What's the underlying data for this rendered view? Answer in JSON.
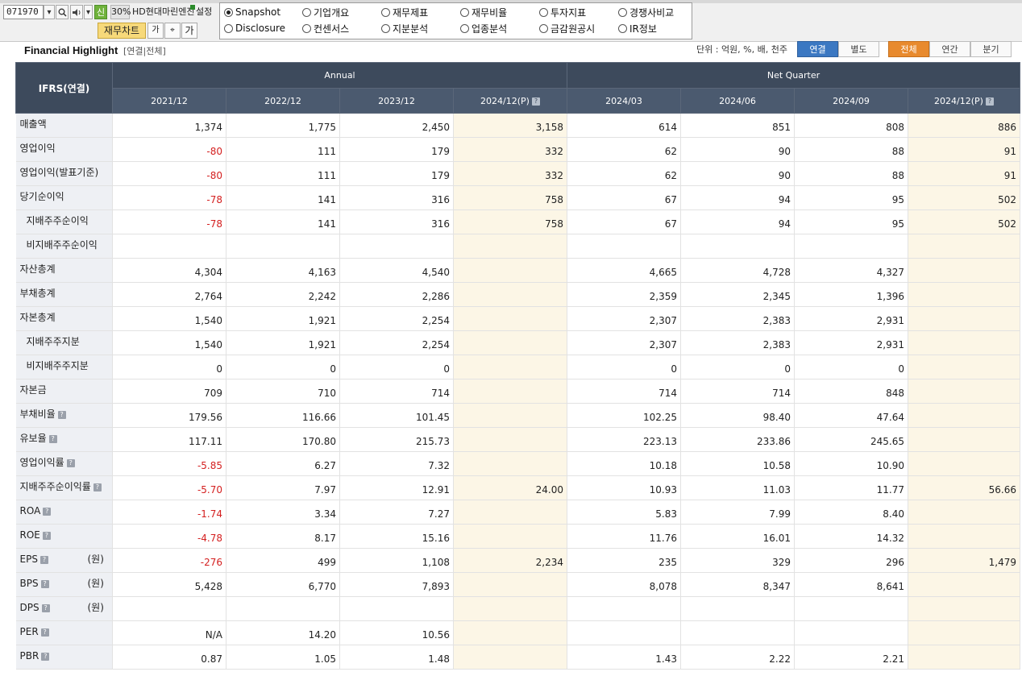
{
  "toolbar": {
    "stock_code": "071970",
    "new_badge": "신",
    "zoom": "30%",
    "company_name": "HD현대마린엔진",
    "settings_label": "설정",
    "fin_chart_button": "재무차트",
    "font_small_glyph": "가",
    "capture_glyph": "⌖",
    "font_large_glyph": "가"
  },
  "menu": {
    "items": [
      {
        "label": "Snapshot",
        "selected": true
      },
      {
        "label": "기업개요",
        "selected": false
      },
      {
        "label": "재무제표",
        "selected": false
      },
      {
        "label": "재무비율",
        "selected": false
      },
      {
        "label": "투자지표",
        "selected": false
      },
      {
        "label": "경쟁사비교",
        "selected": false
      },
      {
        "label": "Disclosure",
        "selected": false
      },
      {
        "label": "컨센서스",
        "selected": false
      },
      {
        "label": "지분분석",
        "selected": false
      },
      {
        "label": "업종분석",
        "selected": false
      },
      {
        "label": "금감원공시",
        "selected": false
      },
      {
        "label": "IR정보",
        "selected": false
      }
    ]
  },
  "section": {
    "title": "Financial Highlight",
    "subtitle": "[연결|전체]",
    "unit_label": "단위 : 억원, %, 배, 천주",
    "basis_tabs": [
      "연결",
      "별도"
    ],
    "period_tabs": [
      "전체",
      "연간",
      "분기"
    ]
  },
  "table": {
    "corner_label": "IFRS(연결)",
    "groups": [
      "Annual",
      "Net Quarter"
    ],
    "columns": [
      "2021/12",
      "2022/12",
      "2023/12",
      "2024/12(P)",
      "2024/03",
      "2024/06",
      "2024/09",
      "2024/12(P)"
    ],
    "help_icon": "?",
    "rows": [
      {
        "label": "매출액",
        "help": false,
        "unit": "",
        "values": [
          "1,374",
          "1,775",
          "2,450",
          "3,158",
          "614",
          "851",
          "808",
          "886"
        ]
      },
      {
        "label": "영업이익",
        "help": false,
        "unit": "",
        "values": [
          "-80",
          "111",
          "179",
          "332",
          "62",
          "90",
          "88",
          "91"
        ]
      },
      {
        "label": "영업이익(발표기준)",
        "help": false,
        "unit": "",
        "values": [
          "-80",
          "111",
          "179",
          "332",
          "62",
          "90",
          "88",
          "91"
        ]
      },
      {
        "label": "당기순이익",
        "help": false,
        "unit": "",
        "values": [
          "-78",
          "141",
          "316",
          "758",
          "67",
          "94",
          "95",
          "502"
        ]
      },
      {
        "label": "지배주주순이익",
        "help": false,
        "unit": "",
        "indent": true,
        "values": [
          "-78",
          "141",
          "316",
          "758",
          "67",
          "94",
          "95",
          "502"
        ]
      },
      {
        "label": "비지배주주순이익",
        "help": false,
        "unit": "",
        "indent": true,
        "values": [
          "",
          "",
          "",
          "",
          "",
          "",
          "",
          ""
        ]
      },
      {
        "label": "자산총계",
        "help": false,
        "unit": "",
        "values": [
          "4,304",
          "4,163",
          "4,540",
          "",
          "4,665",
          "4,728",
          "4,327",
          ""
        ]
      },
      {
        "label": "부채총계",
        "help": false,
        "unit": "",
        "values": [
          "2,764",
          "2,242",
          "2,286",
          "",
          "2,359",
          "2,345",
          "1,396",
          ""
        ]
      },
      {
        "label": "자본총계",
        "help": false,
        "unit": "",
        "values": [
          "1,540",
          "1,921",
          "2,254",
          "",
          "2,307",
          "2,383",
          "2,931",
          ""
        ]
      },
      {
        "label": "지배주주지분",
        "help": false,
        "unit": "",
        "indent": true,
        "values": [
          "1,540",
          "1,921",
          "2,254",
          "",
          "2,307",
          "2,383",
          "2,931",
          ""
        ]
      },
      {
        "label": "비지배주주지분",
        "help": false,
        "unit": "",
        "indent": true,
        "values": [
          "0",
          "0",
          "0",
          "",
          "0",
          "0",
          "0",
          ""
        ]
      },
      {
        "label": "자본금",
        "help": false,
        "unit": "",
        "values": [
          "709",
          "710",
          "714",
          "",
          "714",
          "714",
          "848",
          ""
        ]
      },
      {
        "label": "부채비율",
        "help": true,
        "unit": "",
        "values": [
          "179.56",
          "116.66",
          "101.45",
          "",
          "102.25",
          "98.40",
          "47.64",
          ""
        ]
      },
      {
        "label": "유보율",
        "help": true,
        "unit": "",
        "values": [
          "117.11",
          "170.80",
          "215.73",
          "",
          "223.13",
          "233.86",
          "245.65",
          ""
        ]
      },
      {
        "label": "영업이익률",
        "help": true,
        "unit": "",
        "values": [
          "-5.85",
          "6.27",
          "7.32",
          "",
          "10.18",
          "10.58",
          "10.90",
          ""
        ]
      },
      {
        "label": "지배주주순이익률",
        "help": true,
        "unit": "",
        "values": [
          "-5.70",
          "7.97",
          "12.91",
          "24.00",
          "10.93",
          "11.03",
          "11.77",
          "56.66"
        ]
      },
      {
        "label": "ROA",
        "help": true,
        "unit": "",
        "values": [
          "-1.74",
          "3.34",
          "7.27",
          "",
          "5.83",
          "7.99",
          "8.40",
          ""
        ]
      },
      {
        "label": "ROE",
        "help": true,
        "unit": "",
        "values": [
          "-4.78",
          "8.17",
          "15.16",
          "",
          "11.76",
          "16.01",
          "14.32",
          ""
        ]
      },
      {
        "label": "EPS",
        "help": true,
        "unit": "(원)",
        "values": [
          "-276",
          "499",
          "1,108",
          "2,234",
          "235",
          "329",
          "296",
          "1,479"
        ]
      },
      {
        "label": "BPS",
        "help": true,
        "unit": "(원)",
        "values": [
          "5,428",
          "6,770",
          "7,893",
          "",
          "8,078",
          "8,347",
          "8,641",
          ""
        ]
      },
      {
        "label": "DPS",
        "help": true,
        "unit": "(원)",
        "values": [
          "",
          "",
          "",
          "",
          "",
          "",
          "",
          ""
        ]
      },
      {
        "label": "PER",
        "help": true,
        "unit": "",
        "values": [
          "N/A",
          "14.20",
          "10.56",
          "",
          "",
          "",
          "",
          ""
        ]
      },
      {
        "label": "PBR",
        "help": true,
        "unit": "",
        "values": [
          "0.87",
          "1.05",
          "1.48",
          "",
          "1.43",
          "2.22",
          "2.21",
          ""
        ]
      }
    ]
  },
  "colors": {
    "header_bg": "#3d4a5c",
    "negative": "#d42020",
    "projection_bg": "#fcf6e6",
    "tab_blue": "#3b78c2",
    "tab_orange": "#e88a2e"
  }
}
